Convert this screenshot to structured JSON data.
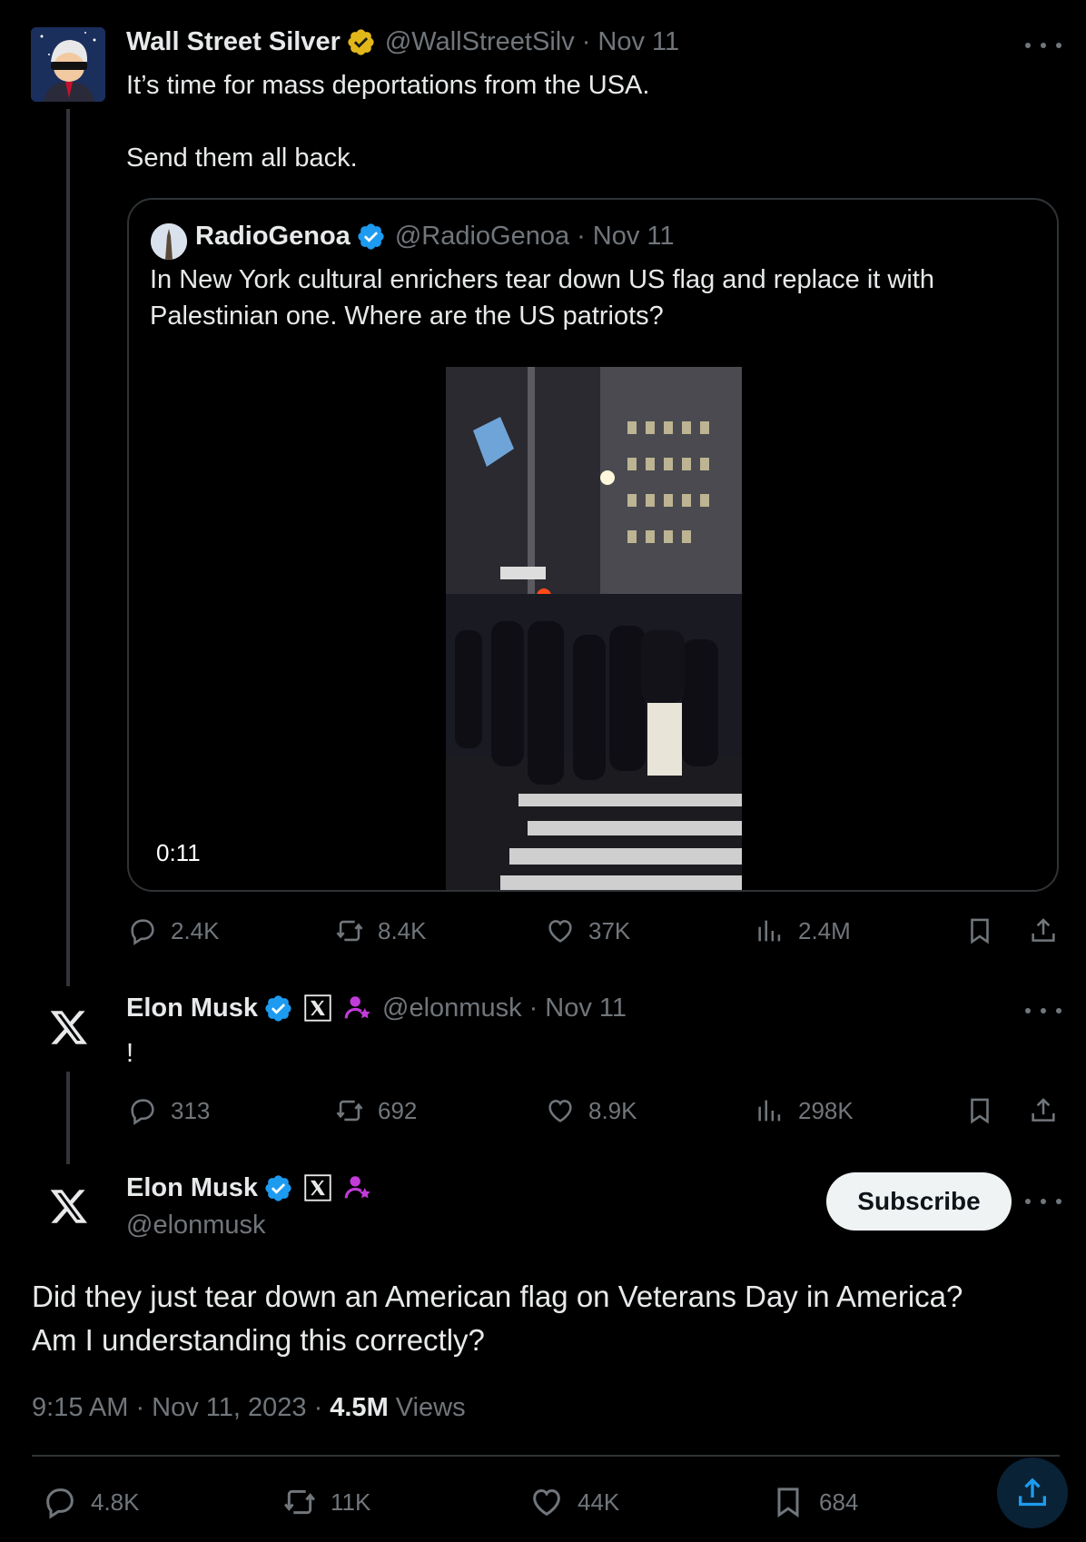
{
  "tweet1": {
    "name": "Wall Street Silver",
    "handle": "@WallStreetSilv",
    "time": "· Nov 11",
    "line1": "It’s time for mass deportations from the USA.",
    "line2": "Send them all back.",
    "verified_color": "#e2b719"
  },
  "quote": {
    "name": "RadioGenoa",
    "handle": "@RadioGenoa",
    "time": "· Nov 11",
    "line1": "In New York cultural enrichers tear down US flag and replace it with",
    "line2": "Palestinian one. Where are the US patriots?",
    "video_time": "0:11",
    "verified_color": "#1d9bf0"
  },
  "tweet1_stats": {
    "replies": "2.4K",
    "reposts": "8.4K",
    "likes": "37K",
    "views": "2.4M"
  },
  "tweet2": {
    "name": "Elon Musk",
    "handle": "@elonmusk",
    "time": "· Nov 11",
    "text": "!"
  },
  "tweet2_stats": {
    "replies": "313",
    "reposts": "692",
    "likes": "8.9K",
    "views": "298K"
  },
  "main": {
    "name": "Elon Musk",
    "handle": "@elonmusk",
    "subscribe_label": "Subscribe",
    "line1": "Did they just tear down an American flag on Veterans Day in America?",
    "line2": "Am I understanding this correctly?",
    "timestamp": "9:15 AM · Nov 11, 2023 ·",
    "views_count": "4.5M",
    "views_label": "Views"
  },
  "main_stats": {
    "replies": "4.8K",
    "reposts": "11K",
    "likes": "44K",
    "bookmarks": "684"
  },
  "icons": [
    "more-icon",
    "verified-icon",
    "x-logo-icon",
    "subscriber-icon",
    "reply-icon",
    "repost-icon",
    "like-icon",
    "views-icon",
    "bookmark-icon",
    "share-icon"
  ],
  "colors": {
    "background": "#000000",
    "text": "#e7e9ea",
    "muted": "#71767b",
    "accent": "#1d9bf0",
    "gold": "#e2b719",
    "purple": "#c23bd9"
  }
}
